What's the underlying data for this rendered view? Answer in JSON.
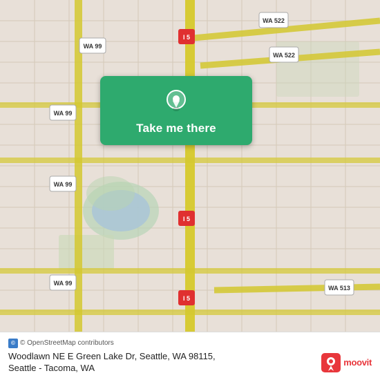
{
  "map": {
    "background_color": "#e8e0d8",
    "center_lat": 47.68,
    "center_lng": -122.33
  },
  "location_card": {
    "button_label": "Take me there",
    "pin_color": "white"
  },
  "attribution": {
    "osm_label": "© OpenStreetMap contributors"
  },
  "address": {
    "line1": "Woodlawn NE E Green Lake Dr, Seattle, WA 98115,",
    "line2": "Seattle - Tacoma, WA"
  },
  "branding": {
    "moovit_label": "moovit"
  },
  "road_labels": {
    "wa99_positions": [
      "top-left area",
      "left side",
      "bottom-left"
    ],
    "i5_positions": [
      "center vertical"
    ],
    "wa522_positions": [
      "top-right"
    ],
    "wa513_positions": [
      "bottom-right"
    ]
  }
}
